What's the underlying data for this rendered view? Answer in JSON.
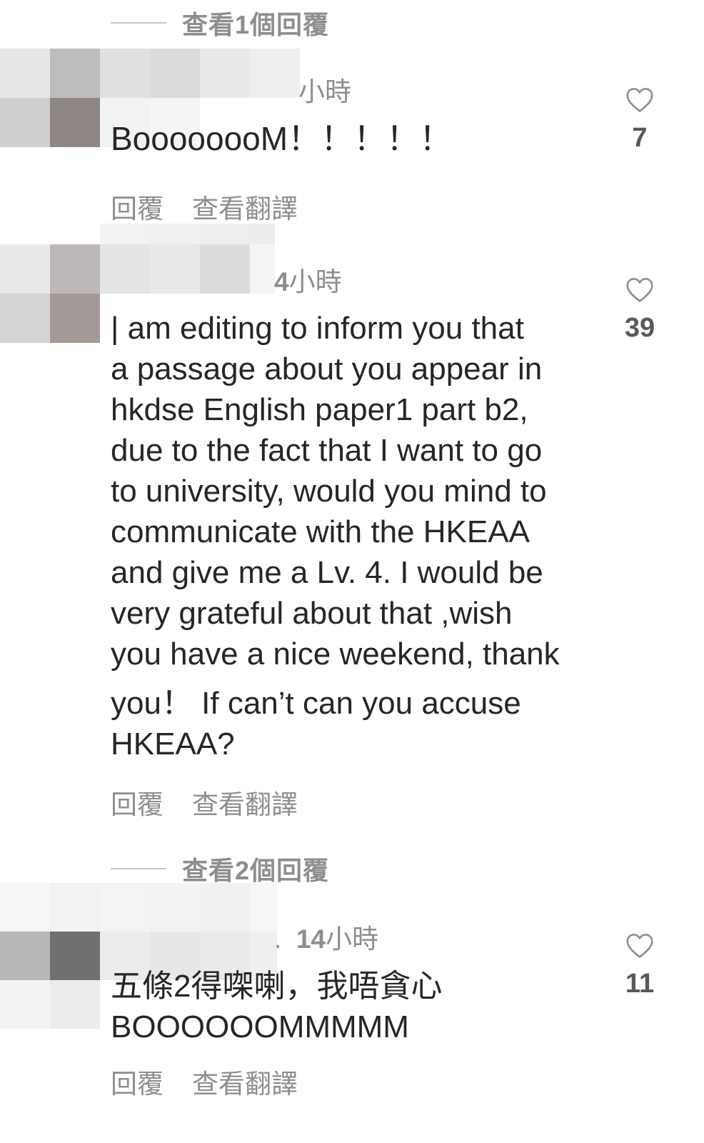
{
  "comments": [
    {
      "view_replies_label": "查看1個回覆",
      "time_label": "小時",
      "text": "BoooooooM！！！！！",
      "reply_label": "回覆",
      "translate_label": "查看翻譯",
      "likes": "7"
    },
    {
      "time_number": "4",
      "time_unit": "小時",
      "text_lines": [
        "| am editing to inform you that",
        "a passage about you appear in",
        "hkdse English paper1 part b2,",
        "due to the fact that I want to go",
        "to university, would you mind to",
        "communicate with the HKEAA",
        "and give me a Lv. 4. I would be",
        "very grateful about that ,wish",
        "you have a nice weekend, thank",
        "you！ If can’t can you accuse",
        "HKEAA?"
      ],
      "reply_label": "回覆",
      "translate_label": "查看翻譯",
      "likes": "39"
    },
    {
      "view_replies_label": "查看2個回覆",
      "time_prefix": ".",
      "time_number": "14",
      "time_unit": "小時",
      "text_lines": [
        "五條2得㗎喇，我唔貪心",
        "BOOOOOOMMMMM"
      ],
      "reply_label": "回覆",
      "translate_label": "查看翻譯",
      "likes": "11"
    }
  ]
}
